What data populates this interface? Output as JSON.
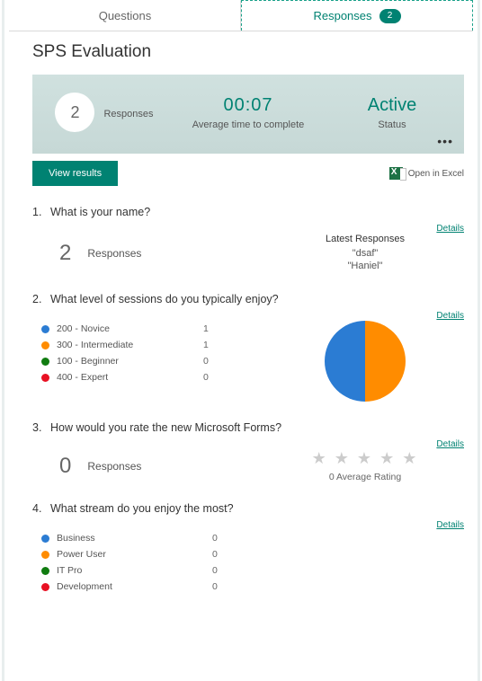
{
  "tabs": {
    "questions": "Questions",
    "responses": "Responses",
    "badge": "2"
  },
  "title": "SPS Evaluation",
  "summary": {
    "count": "2",
    "countLabel": "Responses",
    "time": "00:07",
    "timeLabel": "Average time to complete",
    "status": "Active",
    "statusLabel": "Status"
  },
  "buttons": {
    "viewResults": "View results",
    "openExcel": "Open in Excel"
  },
  "detailsLabel": "Details",
  "q1": {
    "num": "1.",
    "text": "What is your name?",
    "respN": "2",
    "respLabel": "Responses",
    "latestTitle": "Latest Responses",
    "latest": [
      "\"dsaf\"",
      "\"Haniel\""
    ]
  },
  "q2": {
    "num": "2.",
    "text": "What level of sessions do you typically enjoy?",
    "items": [
      {
        "label": "200 - Novice",
        "value": "1",
        "color": "#2b7cd3"
      },
      {
        "label": "300 - Intermediate",
        "value": "1",
        "color": "#ff8c00"
      },
      {
        "label": "100 - Beginner",
        "value": "0",
        "color": "#107c10"
      },
      {
        "label": "400 - Expert",
        "value": "0",
        "color": "#e81123"
      }
    ],
    "pie": {
      "c1": "#ff8c00",
      "c2": "#2b7cd3"
    }
  },
  "q3": {
    "num": "3.",
    "text": "How would you rate the new Microsoft Forms?",
    "respN": "0",
    "respLabel": "Responses",
    "avg": "0 Average Rating"
  },
  "q4": {
    "num": "4.",
    "text": "What stream do you enjoy the most?",
    "items": [
      {
        "label": "Business",
        "value": "0",
        "color": "#2b7cd3"
      },
      {
        "label": "Power User",
        "value": "0",
        "color": "#ff8c00"
      },
      {
        "label": "IT Pro",
        "value": "0",
        "color": "#107c10"
      },
      {
        "label": "Development",
        "value": "0",
        "color": "#e81123"
      }
    ]
  },
  "chart_data": {
    "type": "pie",
    "title": "What level of sessions do you typically enjoy?",
    "categories": [
      "200 - Novice",
      "300 - Intermediate",
      "100 - Beginner",
      "400 - Expert"
    ],
    "values": [
      1,
      1,
      0,
      0
    ]
  }
}
